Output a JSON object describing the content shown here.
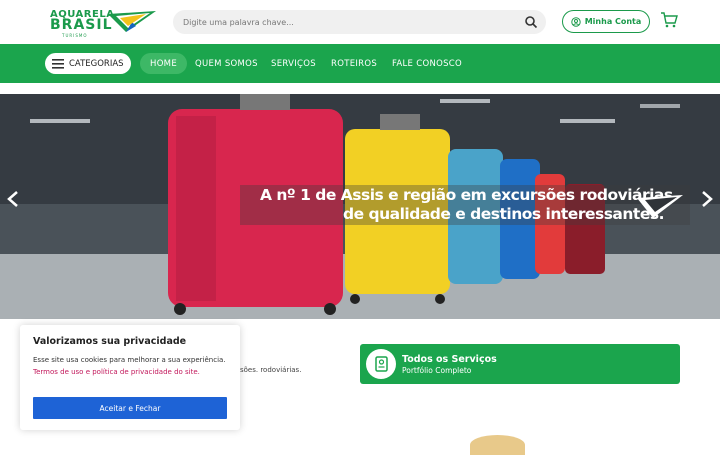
{
  "header": {
    "logo": {
      "line1": "AQUARELA",
      "line2": "BRASIL",
      "line3": "TURISMO"
    },
    "search": {
      "placeholder": "Digite uma palavra chave..."
    },
    "account_label": "Minha Conta"
  },
  "nav": {
    "categories_label": "CATEGORIAS",
    "items": [
      "HOME",
      "QUEM SOMOS",
      "SERVIÇOS",
      "ROTEIROS",
      "FALE CONOSCO"
    ],
    "active": "HOME"
  },
  "hero": {
    "line1": "A nº 1 de Assis e região em excursões rodoviárias",
    "line2": "de qualidade e destinos interessantes."
  },
  "cookie": {
    "title": "Valorizamos sua privacidade",
    "text_before": "Esse site usa cookies para melhorar a sua experiência.",
    "link": "Termos de uso e política de privacidade do site.",
    "button": "Aceitar e Fechar"
  },
  "partial_text": "sões. rodoviárias.",
  "services": {
    "title": "Todos os Serviços",
    "subtitle": "Portfólio Completo"
  },
  "colors": {
    "brand_green": "#1ba54d",
    "button_blue": "#1e63d6",
    "link_pink": "#c2185b"
  }
}
